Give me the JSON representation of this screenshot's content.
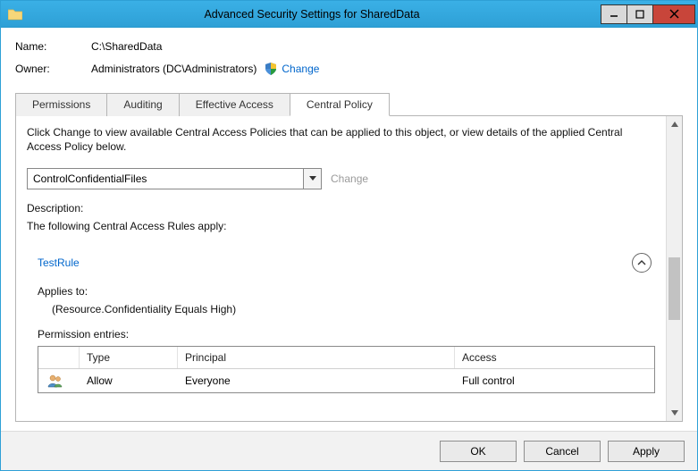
{
  "window": {
    "title": "Advanced Security Settings for SharedData"
  },
  "meta": {
    "name_label": "Name:",
    "name_value": "C:\\SharedData",
    "owner_label": "Owner:",
    "owner_value": "Administrators (DC\\Administrators)",
    "change_link": "Change"
  },
  "tabs": {
    "permissions": "Permissions",
    "auditing": "Auditing",
    "effective": "Effective Access",
    "central": "Central Policy"
  },
  "content": {
    "intro": "Click Change to view available Central Access Policies that can be applied to this object, or view details of the applied Central Access Policy below.",
    "policy_selected": "ControlConfidentialFiles",
    "change_disabled": "Change",
    "description_label": "Description:",
    "rules_intro": "The following Central Access Rules apply:",
    "rule": {
      "name": "TestRule",
      "applies_label": "Applies to:",
      "applies_value": "(Resource.Confidentiality Equals High)",
      "perm_label": "Permission entries:",
      "columns": {
        "type": "Type",
        "principal": "Principal",
        "access": "Access"
      },
      "row": {
        "type": "Allow",
        "principal": "Everyone",
        "access": "Full control"
      }
    }
  },
  "buttons": {
    "ok": "OK",
    "cancel": "Cancel",
    "apply": "Apply"
  }
}
